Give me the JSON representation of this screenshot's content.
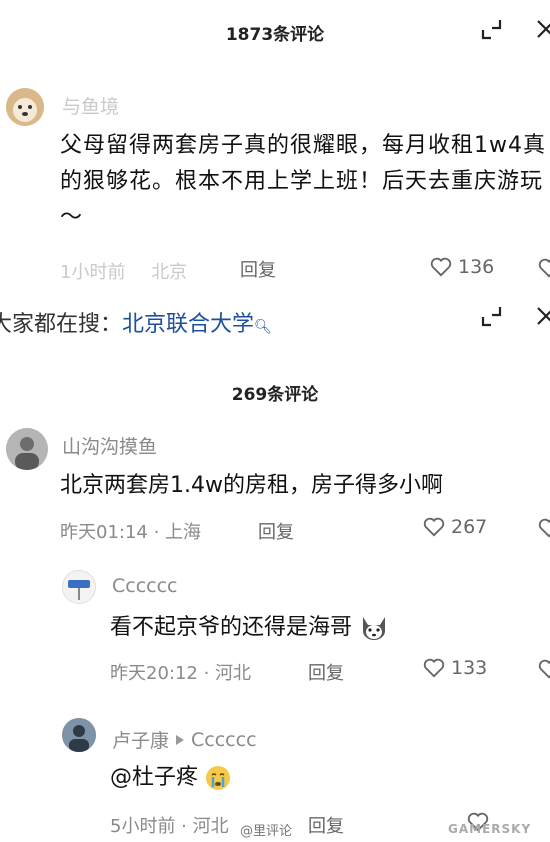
{
  "panel1": {
    "comment_count": "1873条评论",
    "comment": {
      "username": "与鱼境",
      "text": "父母留得两套房子真的很耀眼，每月收租1w4真的狠够花。根本不用上学上班！后天去重庆游玩～",
      "time": "1小时前",
      "location": "北京",
      "reply_label": "回复",
      "likes": "136"
    }
  },
  "search_bar": {
    "prefix": "大家都在搜：",
    "query": "北京联合大学"
  },
  "panel2": {
    "comment_count": "269条评论",
    "comments": [
      {
        "username": "山沟沟摸鱼",
        "text": "北京两套房1.4w的房租，房子得多小啊",
        "time_location": "昨天01:14 · 上海",
        "reply_label": "回复",
        "likes": "267"
      },
      {
        "username": "Cccccc",
        "text": "看不起京爷的还得是海哥",
        "time_location": "昨天20:12 · 河北",
        "reply_label": "回复",
        "likes": "133"
      },
      {
        "username": "卢子康",
        "reply_to": "Cccccc",
        "text": "@杜子疼",
        "time_location": "5小时前 · 河北",
        "reply_label": "回复"
      }
    ]
  },
  "watermark": {
    "weibo": "@里评论",
    "site": "GAMERSKY"
  }
}
